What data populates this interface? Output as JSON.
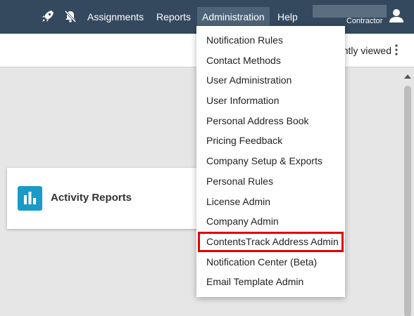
{
  "nav": {
    "links": [
      "Assignments",
      "Reports",
      "Administration",
      "Help"
    ],
    "user_role": "Contractor"
  },
  "subheader": {
    "recent_label": "ntly viewed"
  },
  "card": {
    "title": "Activity Reports"
  },
  "dropdown": {
    "items": [
      "Notification Rules",
      "Contact Methods",
      "User Administration",
      "User Information",
      "Personal Address Book",
      "Pricing Feedback",
      "Company Setup & Exports",
      "Personal Rules",
      "License Admin",
      "Company Admin",
      "ContentsTrack Address Admin",
      "Notification Center (Beta)",
      "Email Template Admin"
    ],
    "highlight_color": "#e00000"
  },
  "colors": {
    "topbar": "#34495e",
    "accent": "#1a9bc7"
  }
}
